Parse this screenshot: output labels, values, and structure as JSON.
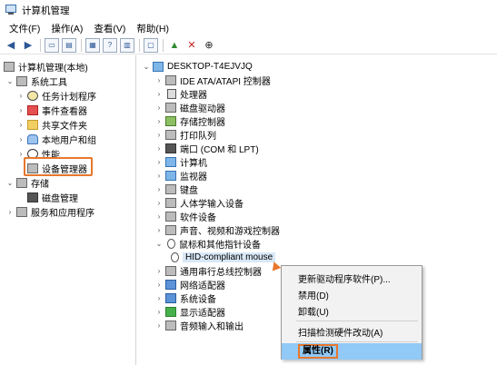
{
  "window": {
    "title": "计算机管理"
  },
  "menubar": {
    "items": [
      "文件(F)",
      "操作(A)",
      "查看(V)",
      "帮助(H)"
    ]
  },
  "left_tree": {
    "root": "计算机管理(本地)",
    "system_tools": "系统工具",
    "task_scheduler": "任务计划程序",
    "event_viewer": "事件查看器",
    "shared_folders": "共享文件夹",
    "local_users": "本地用户和组",
    "performance": "性能",
    "device_manager": "设备管理器",
    "storage": "存储",
    "disk_management": "磁盘管理",
    "services_apps": "服务和应用程序"
  },
  "device_tree": {
    "computer": "DESKTOP-T4EJVJQ",
    "categories": [
      "IDE ATA/ATAPI 控制器",
      "处理器",
      "磁盘驱动器",
      "存储控制器",
      "打印队列",
      "端口 (COM 和 LPT)",
      "计算机",
      "监视器",
      "键盘",
      "人体学输入设备",
      "软件设备",
      "声音、视频和游戏控制器",
      "鼠标和其他指针设备"
    ],
    "selected_device": "HID-compliant mouse",
    "after": [
      "通用串行总线控制器",
      "网络适配器",
      "系统设备",
      "显示适配器",
      "音频输入和输出"
    ]
  },
  "context_menu": {
    "update_driver": "更新驱动程序软件(P)...",
    "disable": "禁用(D)",
    "uninstall": "卸载(U)",
    "scan": "扫描检测硬件改动(A)",
    "properties": "属性(R)"
  },
  "colors": {
    "highlight": "#e8772c",
    "menu_selected": "#91c9f7"
  }
}
